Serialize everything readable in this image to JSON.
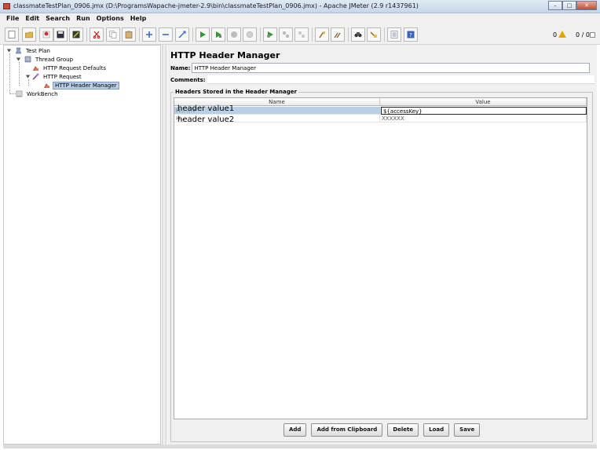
{
  "window": {
    "title": "classmateTestPlan_0906.jmx (D:\\ProgramsWapache-jmeter-2.9\\bin\\classmateTestPlan_0906.jmx) - Apache JMeter (2.9 r1437961)",
    "minimize": "–",
    "maximize": "□",
    "close": "✕"
  },
  "menu": [
    {
      "label": "File"
    },
    {
      "label": "Edit"
    },
    {
      "label": "Search"
    },
    {
      "label": "Run"
    },
    {
      "label": "Options"
    },
    {
      "label": "Help"
    }
  ],
  "toolbar": {
    "status_warnings": "0",
    "status_threads": "0 / 0"
  },
  "tree": {
    "items": [
      {
        "label": "Test Plan",
        "icon": "test-plan-icon"
      },
      {
        "label": "Thread Group",
        "icon": "thread-group-icon"
      },
      {
        "label": "HTTP Request Defaults",
        "icon": "config-element-icon"
      },
      {
        "label": "HTTP Request",
        "icon": "sampler-icon"
      },
      {
        "label": "HTTP Header Manager",
        "icon": "config-element-icon"
      },
      {
        "label": "WorkBench",
        "icon": "workbench-icon"
      }
    ]
  },
  "main": {
    "title": "HTTP Header Manager",
    "name_label": "Name:",
    "name_value": "HTTP Header Manager",
    "comments_label": "Comments:",
    "group_title": "Headers Stored in the Header Manager",
    "columns": [
      "Name",
      "Value"
    ],
    "rows": [
      {
        "name": "header value1",
        "name_underlay": "H... ...Y",
        "value": "${accessKey}"
      },
      {
        "name": "header value2",
        "name_underlay": "H...",
        "value": "XXXXXX"
      }
    ],
    "buttons": {
      "add": "Add",
      "add_clipboard": "Add from Clipboard",
      "delete": "Delete",
      "load": "Load",
      "save": "Save"
    }
  },
  "colors": {
    "selection": "#b8cfe5",
    "panel_bg": "#f0f0f0",
    "run_green": "#2e9b2e",
    "warning": "#e0a400"
  }
}
